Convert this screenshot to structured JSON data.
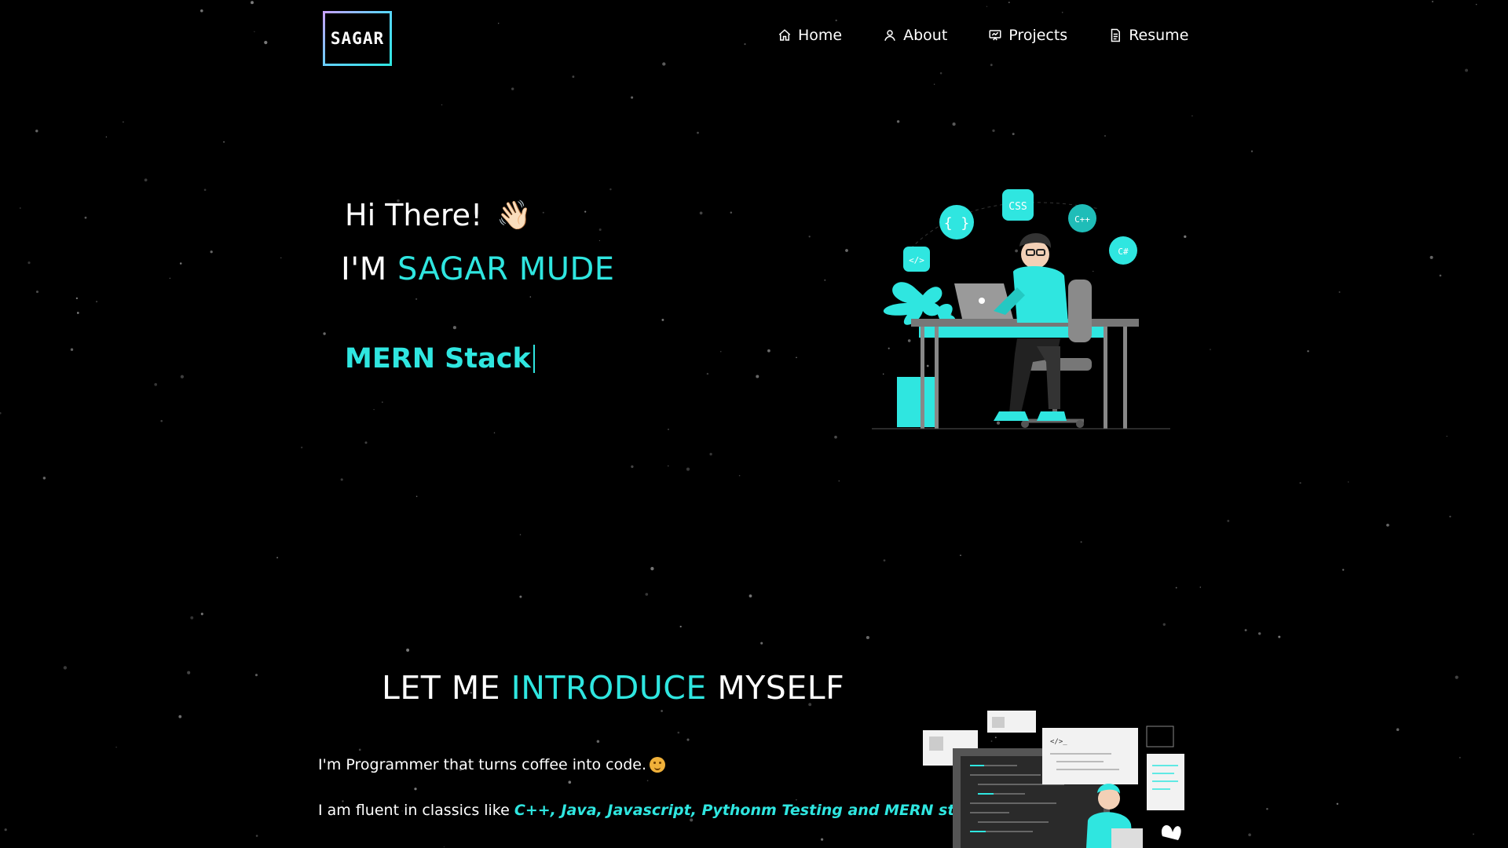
{
  "brand": {
    "logo_text": "SAGAR"
  },
  "nav": {
    "items": [
      {
        "label": "Home",
        "icon": "home-icon"
      },
      {
        "label": "About",
        "icon": "user-icon"
      },
      {
        "label": "Projects",
        "icon": "presentation-icon"
      },
      {
        "label": "Resume",
        "icon": "document-icon"
      }
    ]
  },
  "hero": {
    "greeting": "Hi There!",
    "wave_emoji": "👋🏻",
    "name_prefix": "I'M",
    "name": "SAGAR MUDE",
    "typed_text": "MERN Stack",
    "illustration_badges": [
      "{ }",
      "CSS",
      "C++",
      "C#",
      "</>"
    ]
  },
  "about": {
    "title_part1": "LET ME",
    "title_accent": "INTRODUCE",
    "title_part2": "MYSELF",
    "line1": "I'm Programmer that turns coffee into code.",
    "line2_prefix": "I am fluent in classics like",
    "line2_langs": "C++, Java, Javascript, Pythonm Testing and MERN stack."
  },
  "colors": {
    "accent": "#2fe6e0",
    "background": "#000000"
  }
}
